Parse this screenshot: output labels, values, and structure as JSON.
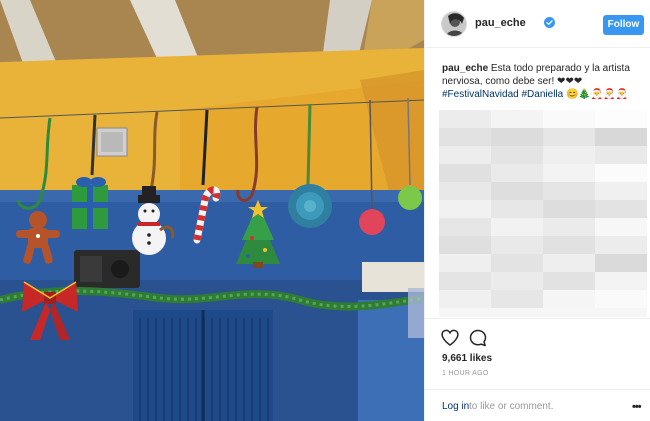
{
  "post": {
    "username": "pau_eche",
    "verified": true,
    "follow_label": "Follow",
    "caption_user": "pau_eche",
    "caption_text": "Esta todo preparado y la artista nerviosa, como debe ser! ❤❤❤",
    "hashtags": [
      "#FestivalNavidad",
      "#Daniella"
    ],
    "caption_emojis": "😊🎄🎅🎅🎅",
    "likes": "9,661 likes",
    "time_ago": "1 HOUR AGO",
    "login_label": "Log in",
    "login_rest": "to like or comment.",
    "more_label": "•••"
  },
  "photo": {
    "subject": "School hall decorated with hanging Christmas ornaments: gingerbread man, gift box, snowman, candy cane, Christmas tree, snowflake and baubles, with tinsel garland and a red bow"
  },
  "colors": {
    "accent": "#3897f0",
    "link": "#003569",
    "wall_blue": "#2d5a9a",
    "wall_yellow": "#e9b33a"
  }
}
